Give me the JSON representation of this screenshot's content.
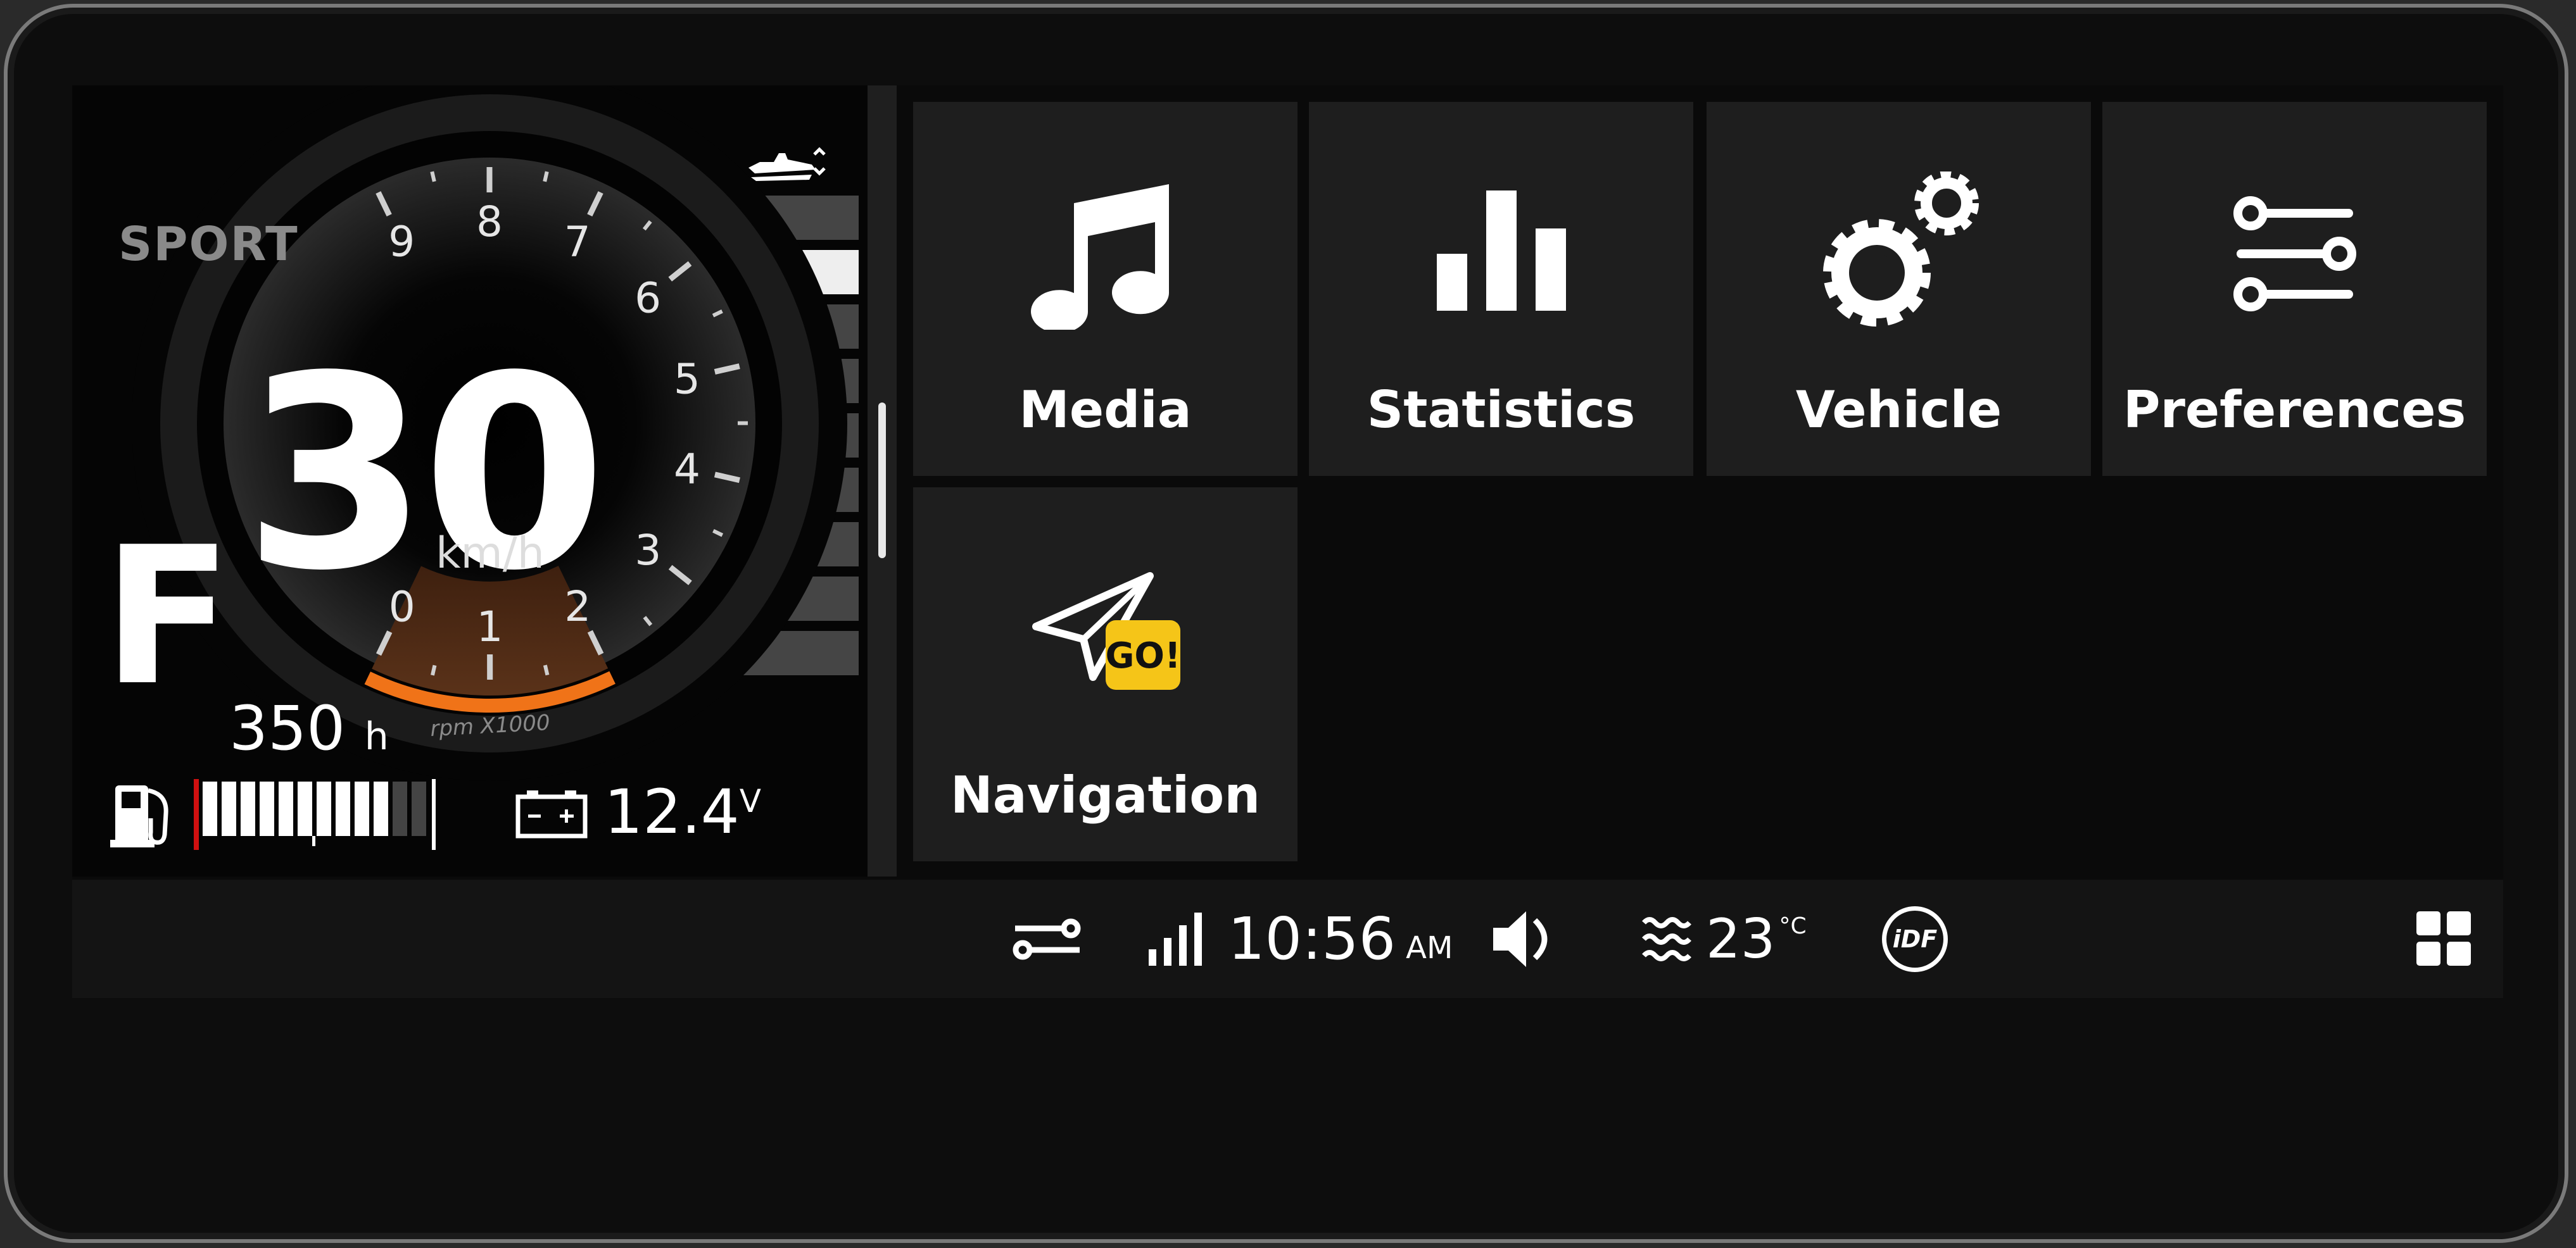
{
  "cluster": {
    "mode": "SPORT",
    "speed": "30",
    "speed_unit": "km/h",
    "gear": "F",
    "engine_hours": "350",
    "engine_hours_unit": "h",
    "rpm_label": "rpm X1000",
    "rpm_ticks": [
      "0",
      "1",
      "2",
      "3",
      "4",
      "5",
      "6",
      "7",
      "8",
      "9"
    ],
    "rpm_highlight_range": [
      0,
      2
    ],
    "fuel": {
      "segments_total": 12,
      "segments_filled": 10
    },
    "battery_voltage": "12.4",
    "battery_unit": "V",
    "trim": {
      "bars_total": 9,
      "active_index": 1
    },
    "icons": {
      "trim": "jet-ski-trim-icon",
      "fuel": "fuel-pump-icon",
      "battery": "battery-icon"
    }
  },
  "tiles": [
    {
      "label": "Media",
      "icon": "music-note-icon"
    },
    {
      "label": "Statistics",
      "icon": "bar-chart-icon"
    },
    {
      "label": "Vehicle",
      "icon": "gears-icon"
    },
    {
      "label": "Preferences",
      "icon": "sliders-icon"
    },
    {
      "label": "Navigation",
      "icon": "paper-plane-icon",
      "badge": "GO!"
    }
  ],
  "statusbar": {
    "time": "10:56",
    "ampm": "AM",
    "water_temp": "23",
    "temp_unit": "°C",
    "idf_label": "iDF"
  },
  "colors": {
    "accent_orange": "#f07318",
    "rpm_zone": "#4a2714",
    "badge_yellow": "#f5c518",
    "tile_bg": "#1e1e1e"
  }
}
